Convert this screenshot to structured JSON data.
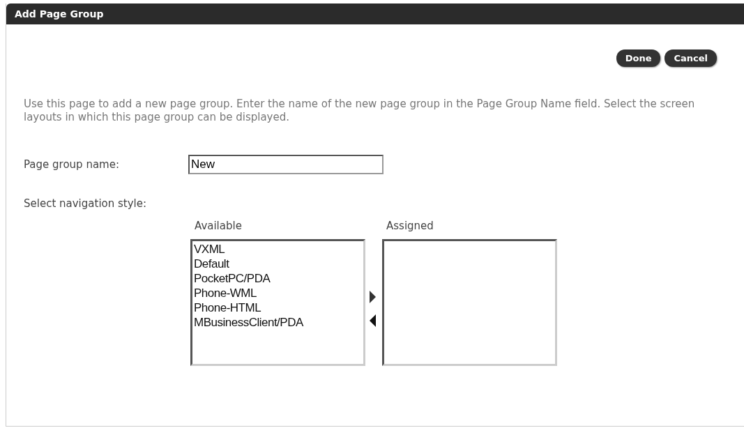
{
  "window": {
    "title": "Add Page Group"
  },
  "buttons": [
    {
      "label": "Done"
    },
    {
      "label": "Cancel"
    }
  ],
  "description": "Use this page to add a new page group. Enter the name of the new page group in the Page Group Name field. Select the screen layouts in which this page group can be displayed.",
  "name_field": {
    "label": "Page group name:",
    "value": "New"
  },
  "navigation": {
    "label": "Select navigation style:",
    "available": {
      "label": "Available",
      "items": [
        "VXML",
        "Default",
        "PocketPC/PDA",
        "Phone-WML",
        "Phone-HTML",
        "MBusinessClient/PDA"
      ]
    },
    "assigned": {
      "label": "Assigned"
    }
  }
}
